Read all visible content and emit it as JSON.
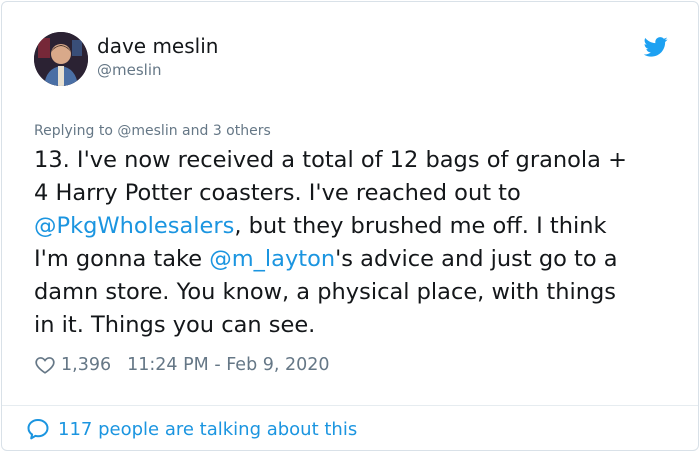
{
  "author": {
    "name": "dave meslin",
    "handle": "@meslin"
  },
  "reply_context": "Replying to @meslin and 3 others",
  "tweet": {
    "lines": [
      [
        {
          "text": "13. I've now received a total of 12 bags of granola +",
          "link": false
        }
      ],
      [
        {
          "text": "4 Harry Potter coasters. I've reached out to",
          "link": false
        }
      ],
      [
        {
          "text": "@PkgWholesalers",
          "link": true
        },
        {
          "text": ", but they brushed me off. I think",
          "link": false
        }
      ],
      [
        {
          "text": "I'm gonna take ",
          "link": false
        },
        {
          "text": "@m_layton",
          "link": true
        },
        {
          "text": "'s advice and just go to a",
          "link": false
        }
      ],
      [
        {
          "text": "damn store. You know, a physical place, with things",
          "link": false
        }
      ],
      [
        {
          "text": "in it. Things you can see.",
          "link": false
        }
      ]
    ]
  },
  "meta": {
    "likes": "1,396",
    "timestamp": "11:24 PM - Feb 9, 2020"
  },
  "footer": {
    "conversation": "117 people are talking about this"
  },
  "icons": {
    "brand": "twitter-bird-icon",
    "like": "heart-icon",
    "conversation": "speech-bubble-icon"
  },
  "colors": {
    "link": "#1b95e0",
    "secondary_text": "#657786",
    "primary_text": "#14171a",
    "twitter_blue": "#1da1f2"
  }
}
